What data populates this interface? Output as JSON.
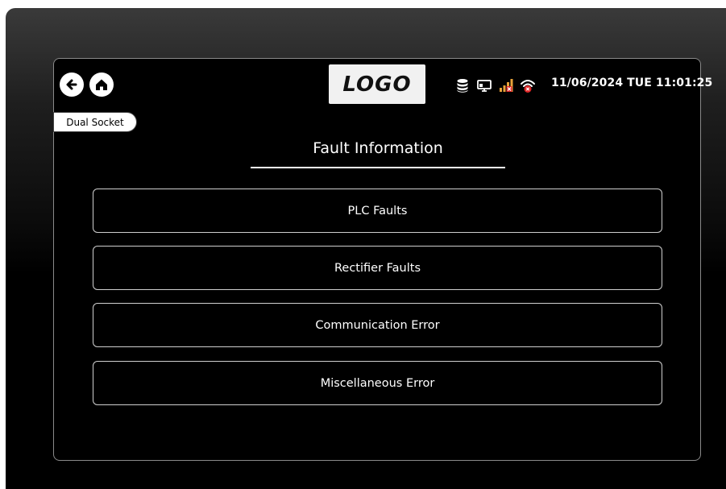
{
  "header": {
    "logo_text": "LOGO",
    "datetime": "11/06/2024 TUE 11:01:25",
    "icons": [
      "back-arrow-icon",
      "home-icon",
      "database-icon",
      "monitor-icon",
      "signal-bars-error-icon",
      "wifi-error-icon"
    ]
  },
  "socket_tab": {
    "label": "Dual Socket"
  },
  "page": {
    "title": "Fault Information"
  },
  "menu": {
    "items": [
      {
        "label": "PLC Faults"
      },
      {
        "label": "Rectifier Faults"
      },
      {
        "label": "Communication Error"
      },
      {
        "label": "Miscellaneous Error"
      }
    ]
  },
  "colors": {
    "background": "#000000",
    "accent_error": "#e02828",
    "signal_bar": "#e8a33a",
    "text": "#ffffff"
  }
}
